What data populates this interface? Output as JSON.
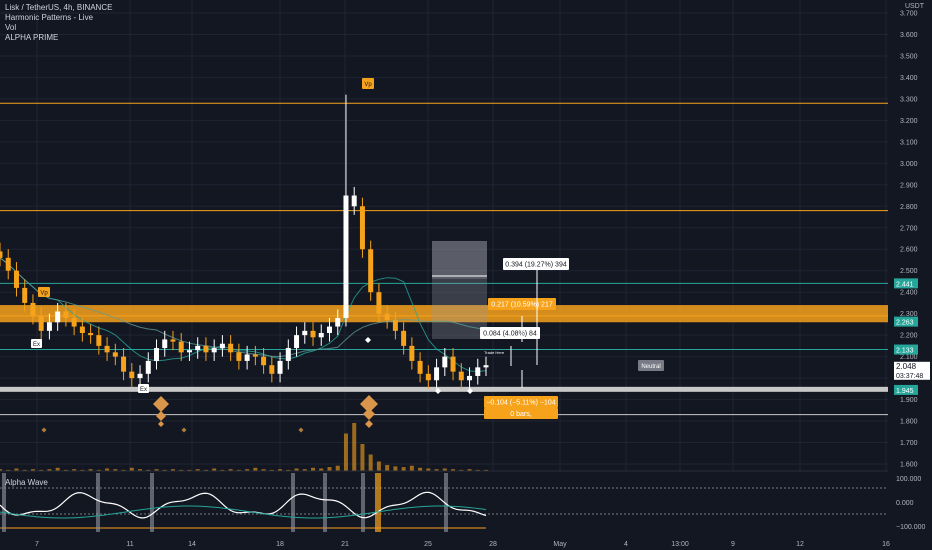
{
  "legend": {
    "symbol_line": "Lisk / TetherUS, 4h, BINANCE",
    "indicators": [
      "Harmonic Patterns - Live",
      "Vol",
      "ALPHA PRIME"
    ]
  },
  "price_axis": {
    "unit": "USDT",
    "ticks": [
      "3.700",
      "3.600",
      "3.500",
      "3.400",
      "3.300",
      "3.200",
      "3.100",
      "3.000",
      "2.900",
      "2.800",
      "2.700",
      "2.600",
      "2.500",
      "2.400",
      "2.300",
      "2.200",
      "2.100",
      "1.900",
      "1.800",
      "1.700",
      "1.600"
    ],
    "badges": [
      {
        "label": "2.441",
        "color": "#26a69a"
      },
      {
        "label": "2.263",
        "color": "#26a69a"
      },
      {
        "label": "2.133",
        "color": "#26a69a"
      },
      {
        "label": "1.945",
        "color": "#26a69a"
      }
    ],
    "last_price": {
      "label": "2.048",
      "countdown": "03:37:48"
    }
  },
  "oscillator": {
    "title": "Alpha Wave",
    "ticks": [
      "100.000",
      "0.000",
      "−100.000"
    ]
  },
  "time_axis": [
    "7",
    "11",
    "14",
    "18",
    "21",
    "25",
    "28",
    "May",
    "4",
    "13:00",
    "9",
    "12",
    "16"
  ],
  "annotations": {
    "measure_up_large": "0.394 (19.27%) 394",
    "measure_up_mid": "0.217 (10.59%) 217",
    "measure_up_small": "0.084 (4.08%) 84",
    "measure_down": "−0.104 (−5.11%) −104",
    "measure_bars": "0 bars,",
    "neutral_tag": "Neutral",
    "vp_top": "Vp",
    "vp_left": "Vp",
    "ex_upper": "Ex",
    "ex_lower": "Ex",
    "small_note": "Trade Here"
  },
  "colors": {
    "background": "#131722",
    "orange": "#f7a21b",
    "teal": "#26a69a",
    "white": "#e6e6e6",
    "grid": "#1f2433"
  },
  "chart_data": {
    "type": "candlestick",
    "symbol": "Lisk / TetherUS",
    "timeframe": "4h",
    "exchange": "BINANCE",
    "ylim": [
      1.55,
      3.75
    ],
    "levels": {
      "orange": [
        3.28,
        2.78,
        2.29
      ],
      "teal": [
        2.441,
        2.133
      ],
      "white": [
        1.945,
        1.83
      ]
    },
    "zone": {
      "from": 2.26,
      "to": 2.34
    },
    "close_path": [
      2.56,
      2.5,
      2.42,
      2.35,
      2.29,
      2.22,
      2.26,
      2.31,
      2.28,
      2.24,
      2.21,
      2.2,
      2.15,
      2.12,
      2.1,
      2.03,
      2.0,
      2.02,
      2.08,
      2.14,
      2.18,
      2.17,
      2.12,
      2.13,
      2.15,
      2.12,
      2.14,
      2.16,
      2.12,
      2.08,
      2.11,
      2.1,
      2.06,
      2.02,
      2.08,
      2.14,
      2.2,
      2.22,
      2.19,
      2.21,
      2.24,
      2.28,
      2.85,
      2.8,
      2.6,
      2.4,
      2.3,
      2.27,
      2.22,
      2.15,
      2.08,
      2.02,
      1.99,
      2.05,
      2.1,
      2.03,
      1.99,
      2.01,
      2.05,
      2.06
    ],
    "volume_path": [
      4,
      3,
      5,
      3,
      4,
      3,
      4,
      6,
      3,
      4,
      3,
      4,
      3,
      5,
      4,
      3,
      6,
      4,
      3,
      4,
      3,
      4,
      3,
      3,
      4,
      3,
      5,
      3,
      4,
      3,
      4,
      6,
      4,
      3,
      4,
      3,
      5,
      4,
      6,
      5,
      7,
      9,
      55,
      70,
      40,
      25,
      15,
      10,
      8,
      7,
      9,
      6,
      5,
      4,
      5,
      4,
      3,
      4,
      3,
      3
    ]
  }
}
